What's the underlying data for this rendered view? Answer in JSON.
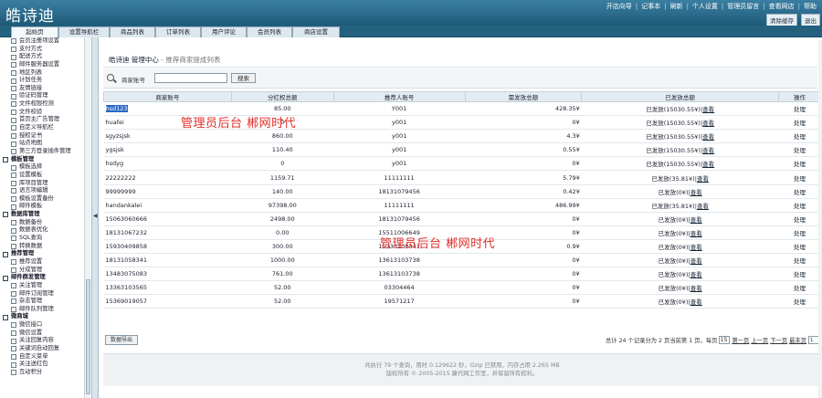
{
  "header": {
    "logo": "皓诗迪",
    "links": [
      "开店向导",
      "记事本",
      "刷新",
      "个人设置",
      "管理员留言",
      "查看网店",
      "帮助"
    ],
    "buttons": [
      "清除缓存",
      "退出"
    ]
  },
  "nav": {
    "tabs": [
      "起始页",
      "设置导航栏",
      "商品列表",
      "订单列表",
      "用户评论",
      "会员列表",
      "商店设置"
    ]
  },
  "sidebar": {
    "items": [
      {
        "label": "会员注册项设置",
        "type": "child"
      },
      {
        "label": "支付方式",
        "type": "child"
      },
      {
        "label": "配送方式",
        "type": "child"
      },
      {
        "label": "邮件服务器设置",
        "type": "child"
      },
      {
        "label": "地区列表",
        "type": "child"
      },
      {
        "label": "计划任务",
        "type": "child"
      },
      {
        "label": "友情链接",
        "type": "child"
      },
      {
        "label": "验证码管理",
        "type": "child"
      },
      {
        "label": "文件权限检测",
        "type": "child"
      },
      {
        "label": "文件校验",
        "type": "child"
      },
      {
        "label": "首页主广告管理",
        "type": "child"
      },
      {
        "label": "自定义导航栏",
        "type": "child"
      },
      {
        "label": "授权证书",
        "type": "child"
      },
      {
        "label": "站点地图",
        "type": "child"
      },
      {
        "label": "第三方登录插件管理",
        "type": "child"
      },
      {
        "label": "模板管理",
        "type": "group"
      },
      {
        "label": "模板选择",
        "type": "child"
      },
      {
        "label": "设置模板",
        "type": "child"
      },
      {
        "label": "库项目管理",
        "type": "child"
      },
      {
        "label": "语言项编辑",
        "type": "child"
      },
      {
        "label": "模板设置备份",
        "type": "child"
      },
      {
        "label": "邮件模板",
        "type": "child"
      },
      {
        "label": "数据库管理",
        "type": "group"
      },
      {
        "label": "数据备份",
        "type": "child"
      },
      {
        "label": "数据表优化",
        "type": "child"
      },
      {
        "label": "SQL查询",
        "type": "child"
      },
      {
        "label": "转换数据",
        "type": "child"
      },
      {
        "label": "推荐管理",
        "type": "group"
      },
      {
        "label": "推荐设置",
        "type": "child"
      },
      {
        "label": "分成管理",
        "type": "child"
      },
      {
        "label": "邮件群发管理",
        "type": "group"
      },
      {
        "label": "关注管理",
        "type": "child"
      },
      {
        "label": "邮件订阅管理",
        "type": "child"
      },
      {
        "label": "杂志管理",
        "type": "child"
      },
      {
        "label": "邮件队列管理",
        "type": "child"
      },
      {
        "label": "微商城",
        "type": "group"
      },
      {
        "label": "微信接口",
        "type": "child"
      },
      {
        "label": "微信设置",
        "type": "child"
      },
      {
        "label": "关注回复内容",
        "type": "child"
      },
      {
        "label": "关键词自动回复",
        "type": "child"
      },
      {
        "label": "自定义菜单",
        "type": "child"
      },
      {
        "label": "关注送红包",
        "type": "child"
      },
      {
        "label": "互动积分",
        "type": "child"
      }
    ]
  },
  "main": {
    "title": "皓诗迪 管理中心",
    "subtitle": " - 推荐商家提成列表",
    "search": {
      "label": "商家账号",
      "value": "",
      "button": "搜索"
    },
    "columns": [
      "商家账号",
      "分红权总额",
      "推荐人账号",
      "需发放总额",
      "已发放总额",
      "操作"
    ],
    "rows": [
      {
        "account": "hsd123",
        "dividend": "85.00",
        "referrer": "Y001",
        "pending": "428.35¥",
        "paid": "已发放(15030.55¥)",
        "view": "查看",
        "op": "处理",
        "selected": true
      },
      {
        "account": "huafei",
        "dividend": "0",
        "referrer": "y001",
        "pending": "0¥",
        "paid": "已发放(15030.55¥)",
        "view": "查看",
        "op": "处理"
      },
      {
        "account": "sgyzsjsk",
        "dividend": "860.00",
        "referrer": "y001",
        "pending": "4.3¥",
        "paid": "已发放(15030.55¥)",
        "view": "查看",
        "op": "处理"
      },
      {
        "account": "ygsjsk",
        "dividend": "110.40",
        "referrer": "y001",
        "pending": "0.55¥",
        "paid": "已发放(15030.55¥)",
        "view": "查看",
        "op": "处理"
      },
      {
        "account": "hsdyg",
        "dividend": "0",
        "referrer": "y001",
        "pending": "0¥",
        "paid": "已发放(15030.55¥)",
        "view": "查看",
        "op": "处理"
      },
      {
        "account": "22222222",
        "dividend": "1159.71",
        "referrer": "11111111",
        "pending": "5.79¥",
        "paid": "已发放(35.81¥)",
        "view": "查看",
        "op": "处理"
      },
      {
        "account": "99999999",
        "dividend": "140.00",
        "referrer": "18131079456",
        "pending": "0.42¥",
        "paid": "已发放(0¥)",
        "view": "查看",
        "op": "处理"
      },
      {
        "account": "handankalei",
        "dividend": "97398.00",
        "referrer": "11111111",
        "pending": "486.99¥",
        "paid": "已发放(35.81¥)",
        "view": "查看",
        "op": "处理"
      },
      {
        "account": "15063060666",
        "dividend": "2498.00",
        "referrer": "18131079456",
        "pending": "0¥",
        "paid": "已发放(0¥)",
        "view": "查看",
        "op": "处理"
      },
      {
        "account": "18131067232",
        "dividend": "0.00",
        "referrer": "15511006649",
        "pending": "0¥",
        "paid": "已发放(0¥)",
        "view": "查看",
        "op": "处理"
      },
      {
        "account": "15930409858",
        "dividend": "300.00",
        "referrer": "15333208341",
        "pending": "0.9¥",
        "paid": "已发放(0¥)",
        "view": "查看",
        "op": "处理"
      },
      {
        "account": "18131058341",
        "dividend": "1000.00",
        "referrer": "13613103738",
        "pending": "0¥",
        "paid": "已发放(0¥)",
        "view": "查看",
        "op": "处理"
      },
      {
        "account": "13483075083",
        "dividend": "761.00",
        "referrer": "13613103738",
        "pending": "0¥",
        "paid": "已发放(0¥)",
        "view": "查看",
        "op": "处理"
      },
      {
        "account": "13363103565",
        "dividend": "52.00",
        "referrer": "03304464",
        "pending": "0¥",
        "paid": "已发放(0¥)",
        "view": "查看",
        "op": "处理"
      },
      {
        "account": "15369019057",
        "dividend": "52.00",
        "referrer": "19571217",
        "pending": "0¥",
        "paid": "已发放(0¥)",
        "view": "查看",
        "op": "处理"
      }
    ],
    "export_button": "数据导出",
    "pagination": {
      "summary": "总计 24 个记录分为 2 页当前第 1 页，每页",
      "per_page": "15",
      "first": "第一页",
      "prev": "上一页",
      "next": "下一页",
      "last": "最末页",
      "page_select": "1"
    },
    "footer": {
      "line1": "共执行 79 个查询，用时 0.129622 秒，Gzip 已禁用，内存占用 2.265 MB",
      "line2": "版权所有 © 2005-2015 康代网工作室，并保留所有权利。"
    },
    "watermarks": [
      "管理员后台 郴网时代",
      "管理员后台 郴网时代"
    ]
  }
}
